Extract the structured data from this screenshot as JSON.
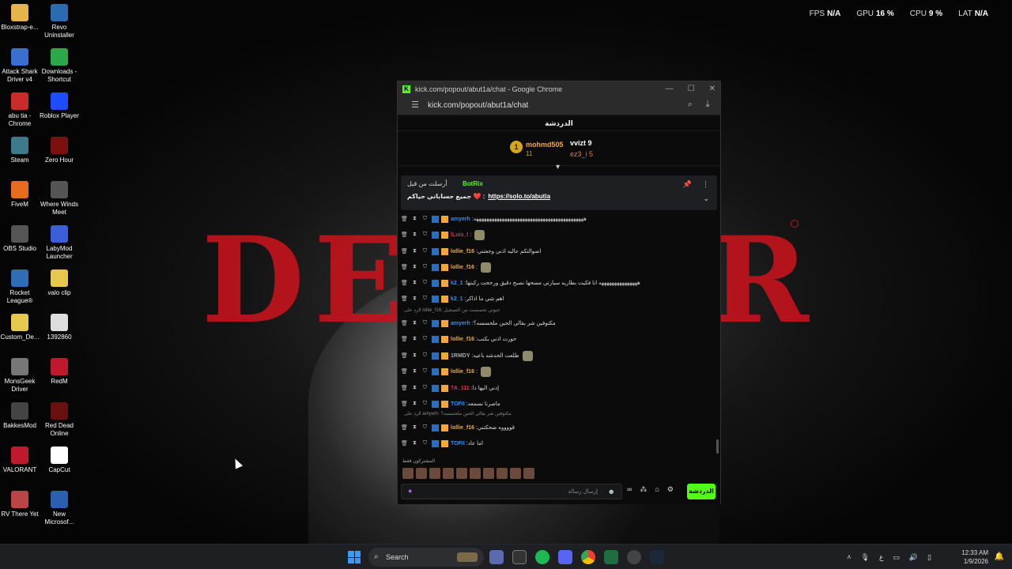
{
  "overlay": [
    {
      "label": "FPS",
      "value": "N/A"
    },
    {
      "label": "GPU",
      "value": "16 %"
    },
    {
      "label": "CPU",
      "value": "9 %"
    },
    {
      "label": "LAT",
      "value": "N/A"
    }
  ],
  "desktop": {
    "col1": [
      "Bloxstrap-e...",
      "Attack Shark Driver v4",
      "abu tia - Chrome",
      "Steam",
      "FiveM",
      "OBS Studio",
      "Rocket League®",
      "Custom_De...",
      "MonsGeek Driver",
      "BakkesMod",
      "VALORANT",
      "RV There Yet"
    ],
    "col2": [
      "Revo Uninstaller",
      "Downloads - Shortcut",
      "Roblox Player",
      "Zero Hour",
      "Where Winds Meet",
      "LabyMod Launcher",
      "valo clip",
      "1392860",
      "RedM",
      "Red Dead Online",
      "CapCut",
      "New Microsof..."
    ]
  },
  "window": {
    "title": "kick.com/popout/abut1a/chat - Google Chrome",
    "url": "kick.com/popout/abut1a/chat",
    "favicon": "K"
  },
  "chat": {
    "header": "الدردشة",
    "leaderboard": {
      "first": {
        "rank": "1",
        "name": "mohmd505",
        "count": "11"
      },
      "second": {
        "name": "vvizt",
        "count": "9"
      },
      "third": {
        "name": "ez3_i",
        "count": "5"
      }
    },
    "pinned": {
      "by": "أرسلت من قبل",
      "user": "BotRix",
      "text": "جميع حساباتي حياكم ❤️ :",
      "link": "https://solo.to/abutia"
    },
    "messages": [
      {
        "user": "amyerh",
        "color": "#3a8ee6",
        "text": "هههههههههههههههههههههههههههههههههههههههههههه"
      },
      {
        "user": "lLuis_l",
        "color": "#d4365a",
        "text": "",
        "emote": true
      },
      {
        "user": "lollie_f16",
        "color": "#f0a83c",
        "text": "اصوالتكم عاليه اذني وجعتني"
      },
      {
        "user": "lollie_f16",
        "color": "#f0a83c",
        "text": "",
        "emote": true
      },
      {
        "user": "k2_1",
        "color": "#3a8ee6",
        "text": "هههههههههههههههه انا فكيت بطاريه سيارتي مسحها نصبح دقيق ورجحت ركبتها"
      },
      {
        "user": "k2_1",
        "color": "#3a8ee6",
        "text": "اهم شي ما اذاكر"
      },
      {
        "user": "amyerh",
        "color": "#3a8ee6",
        "text": "مكتوفين شر بقالي الحين ملحسسه؟"
      },
      {
        "user": "lollie_f16",
        "color": "#f0a83c",
        "text": "حورت اذني بكتب"
      },
      {
        "user": "1RMDY",
        "color": "#aaa",
        "text": "طلعت الحدشه باعيه",
        "emote": true
      },
      {
        "user": "lollie_f16",
        "color": "#f0a83c",
        "text": "",
        "emote": true
      },
      {
        "user": "7A_111",
        "color": "#d4365a",
        "text": "إدني اليها دا"
      },
      {
        "user": "TOFII",
        "color": "#3a8ee6",
        "text": "ماصرنا نسمعه"
      },
      {
        "user": "lollie_f16",
        "color": "#f0a83c",
        "text": "قووووه ضحكتني"
      },
      {
        "user": "TOFII",
        "color": "#3a8ee6",
        "text": "اما عاد"
      }
    ],
    "replies": [
      {
        "text": "الرد على lollie_f16: حبوتي تحسست من التسجيل"
      },
      {
        "text": "الرد على amyerh: مكتوفين شر بقالي الحين ملحسسه؟"
      }
    ],
    "subs_label": "المشتركون فقط",
    "input_placeholder": "إرسال رسالة",
    "send_label": "الدردشة"
  },
  "taskbar": {
    "search": "Search",
    "lang": "ع",
    "time": "12:33 AM",
    "date": "1/9/2026"
  }
}
